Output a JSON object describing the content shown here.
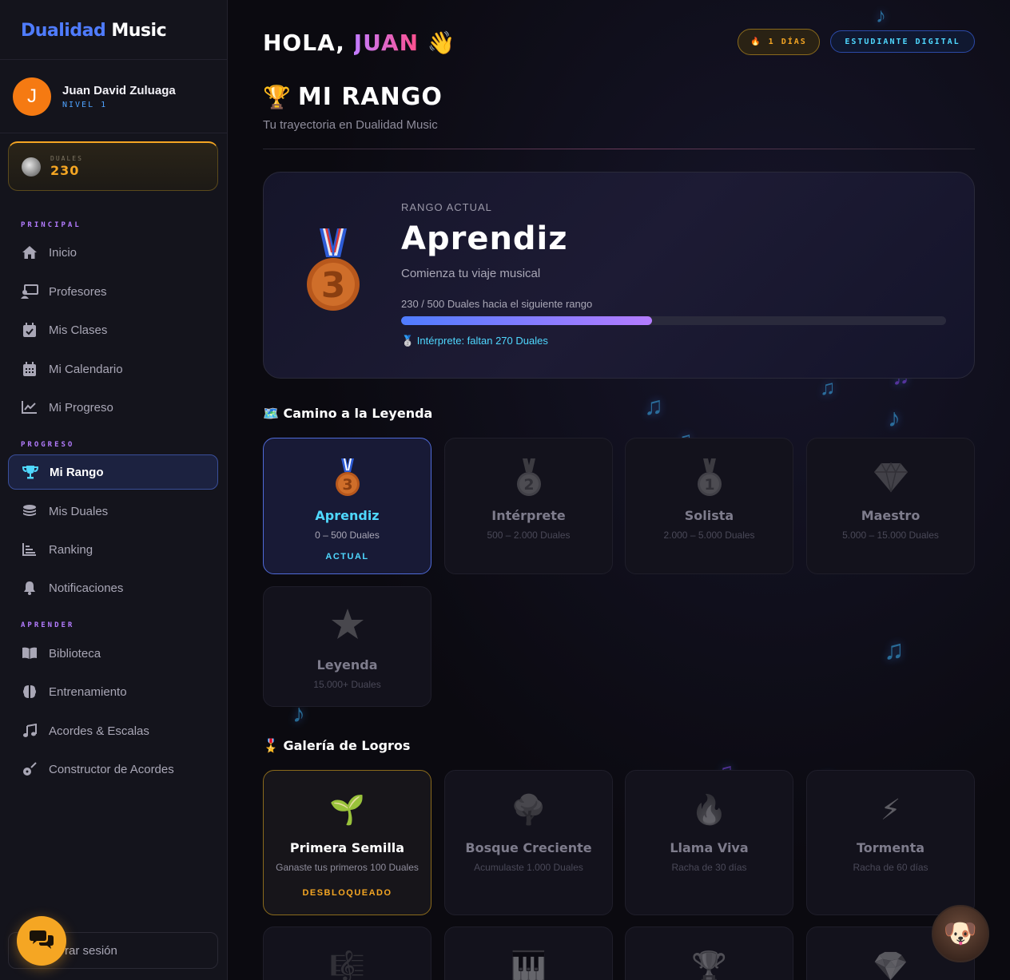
{
  "brand": {
    "part1": "Dualidad",
    "part2": "Music"
  },
  "user": {
    "initial": "J",
    "name": "Juan David Zuluaga",
    "level": "NIVEL 1"
  },
  "duales": {
    "label": "DUALES",
    "value": "230"
  },
  "sections": {
    "principal": "PRINCIPAL",
    "progreso": "PROGRESO",
    "aprender": "APRENDER"
  },
  "nav": {
    "inicio": "Inicio",
    "profesores": "Profesores",
    "mis_clases": "Mis Clases",
    "mi_calendario": "Mi Calendario",
    "mi_progreso": "Mi Progreso",
    "mi_rango": "Mi Rango",
    "mis_duales": "Mis Duales",
    "ranking": "Ranking",
    "notificaciones": "Notificaciones",
    "biblioteca": "Biblioteca",
    "entrenamiento": "Entrenamiento",
    "acordes": "Acordes & Escalas",
    "constructor": "Constructor de Acordes"
  },
  "logout": "rar sesión",
  "header": {
    "greeting": "HOLA,",
    "name": "JUAN",
    "wave": "👋",
    "streak": "🔥 1 DÍAS",
    "role": "ESTUDIANTE DIGITAL"
  },
  "page": {
    "title": "MI RANGO",
    "trophy": "🏆",
    "subtitle": "Tu trayectoria en Dualidad Music"
  },
  "current_rank": {
    "label": "RANGO ACTUAL",
    "name": "Aprendiz",
    "description": "Comienza tu viaje musical",
    "progress_text": "230 / 500 Duales hacia el siguiente rango",
    "progress_fraction": 0.46,
    "next_text": "🥈 Intérprete: faltan 270 Duales",
    "medal": "🥉"
  },
  "path": {
    "title": "🗺️ Camino a la Leyenda",
    "ranks": [
      {
        "icon": "🥉",
        "name": "Aprendiz",
        "range": "0 – 500 Duales",
        "tag": "ACTUAL"
      },
      {
        "icon": "🥈",
        "name": "Intérprete",
        "range": "500 – 2.000 Duales",
        "tag": ""
      },
      {
        "icon": "🥇",
        "name": "Solista",
        "range": "2.000 – 5.000 Duales",
        "tag": ""
      },
      {
        "icon": "💎",
        "name": "Maestro",
        "range": "5.000 – 15.000 Duales",
        "tag": ""
      },
      {
        "icon": "🌟",
        "name": "Leyenda",
        "range": "15.000+ Duales",
        "tag": ""
      }
    ]
  },
  "achievements": {
    "title": "🎖️ Galería de Logros",
    "items": [
      {
        "icon": "🌱",
        "name": "Primera Semilla",
        "desc": "Ganaste tus primeros 100 Duales",
        "tag": "DESBLOQUEADO"
      },
      {
        "icon": "🌳",
        "name": "Bosque Creciente",
        "desc": "Acumulaste 1.000 Duales",
        "tag": ""
      },
      {
        "icon": "🔥",
        "name": "Llama Viva",
        "desc": "Racha de 30 días",
        "tag": ""
      },
      {
        "icon": "⚡",
        "name": "Tormenta",
        "desc": "Racha de 60 días",
        "tag": ""
      },
      {
        "icon": "🎼",
        "name": "",
        "desc": "",
        "tag": ""
      },
      {
        "icon": "🎹",
        "name": "",
        "desc": "",
        "tag": ""
      },
      {
        "icon": "🏆",
        "name": "",
        "desc": "",
        "tag": ""
      },
      {
        "icon": "💎",
        "name": "",
        "desc": "",
        "tag": ""
      }
    ]
  },
  "icons": {
    "home": "home-icon",
    "teacher": "teacher-icon",
    "calendar-check": "calendar-check-icon",
    "calendar": "calendar-icon",
    "chart": "chart-line-icon",
    "trophy": "trophy-icon",
    "coins": "coins-icon",
    "ranking": "ranking-icon",
    "bell": "bell-icon",
    "book": "book-icon",
    "brain": "brain-icon",
    "music": "music-icon",
    "guitar": "guitar-icon",
    "chat": "chat-icon"
  },
  "colors": {
    "accent_blue": "#4f7cff",
    "accent_gold": "#f5a623",
    "accent_cyan": "#4fd8ff",
    "accent_purple": "#b47cff",
    "bg": "#0b0a10"
  }
}
